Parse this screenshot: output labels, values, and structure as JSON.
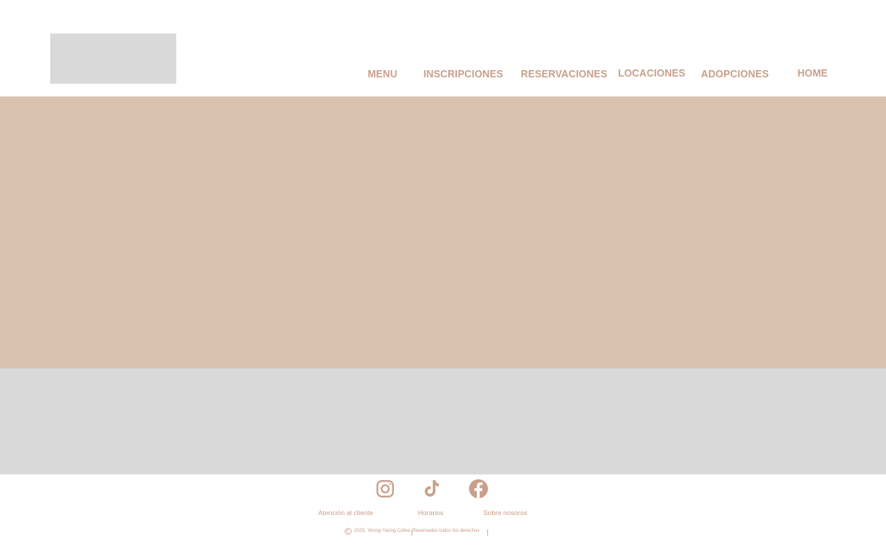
{
  "header": {
    "nav": [
      {
        "label": "MENU"
      },
      {
        "label": "INSCRIPCIONES"
      },
      {
        "label": "RESERVACIONES"
      },
      {
        "label": "LOCACIONES"
      },
      {
        "label": "ADOPCIONES"
      },
      {
        "label": "HOME"
      }
    ]
  },
  "footer": {
    "social": [
      "instagram-icon",
      "tiktok-icon",
      "facebook-icon"
    ],
    "links": [
      {
        "label": "Atención al cliente"
      },
      {
        "label": "Horarios"
      },
      {
        "label": "Sobre nosoros"
      }
    ],
    "copyright": "2025, Yeong-Yaong Cofee. Reservados todos los derechos"
  },
  "colors": {
    "accent": "#c89f8b",
    "hero": "#dac2b1",
    "placeholder": "#d9d9d9"
  }
}
